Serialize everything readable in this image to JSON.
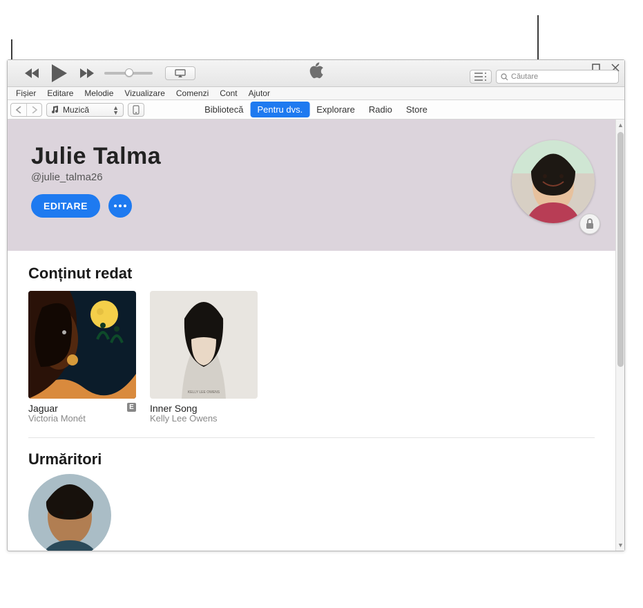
{
  "menubar": {
    "items": [
      "Fișier",
      "Editare",
      "Melodie",
      "Vizualizare",
      "Comenzi",
      "Cont",
      "Ajutor"
    ]
  },
  "search": {
    "placeholder": "Căutare"
  },
  "source_selector": {
    "label": "Muzică"
  },
  "nav_tabs": {
    "items": [
      "Bibliotecă",
      "Pentru dvs.",
      "Explorare",
      "Radio",
      "Store"
    ],
    "active_index": 1
  },
  "profile": {
    "name": "Julie Talma",
    "handle": "@julie_talma26",
    "edit_label": "EDITARE"
  },
  "sections": {
    "listening": {
      "title": "Conținut redat"
    },
    "followers": {
      "title": "Urmăritori"
    }
  },
  "albums": [
    {
      "title": "Jaguar",
      "artist": "Victoria Monét",
      "explicit": true
    },
    {
      "title": "Inner Song",
      "artist": "Kelly Lee Owens",
      "explicit": false
    }
  ],
  "icons": {
    "explicit_badge": "E"
  }
}
